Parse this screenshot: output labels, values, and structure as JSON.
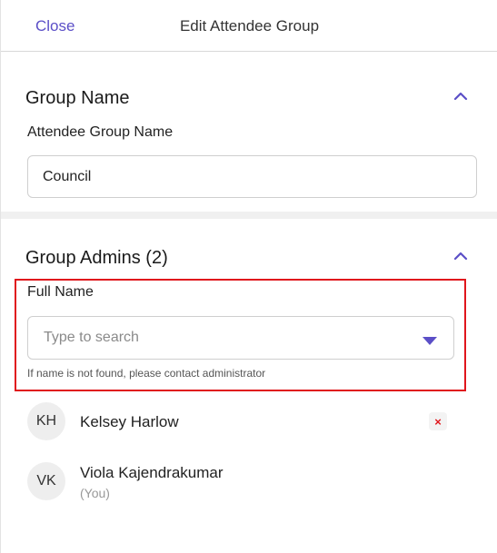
{
  "header": {
    "close_label": "Close",
    "title": "Edit Attendee Group"
  },
  "group_name_section": {
    "title": "Group Name",
    "field_label": "Attendee Group Name",
    "field_value": "Council"
  },
  "group_admins_section": {
    "title": "Group Admins (2)",
    "field_label": "Full Name",
    "search_placeholder": "Type to search",
    "helper_text": "If name is not found, please contact administrator",
    "admins": [
      {
        "initials": "KH",
        "name": "Kelsey Harlow",
        "sub": ""
      },
      {
        "initials": "VK",
        "name": "Viola Kajendrakumar",
        "sub": "(You)"
      }
    ]
  },
  "colors": {
    "accent": "#5b4fc7",
    "highlight_border": "#e0161c",
    "remove_icon": "#e0161c"
  },
  "icons": {
    "collapse": "chevron-up-icon",
    "dropdown": "caret-down-icon",
    "remove": "close-icon"
  }
}
